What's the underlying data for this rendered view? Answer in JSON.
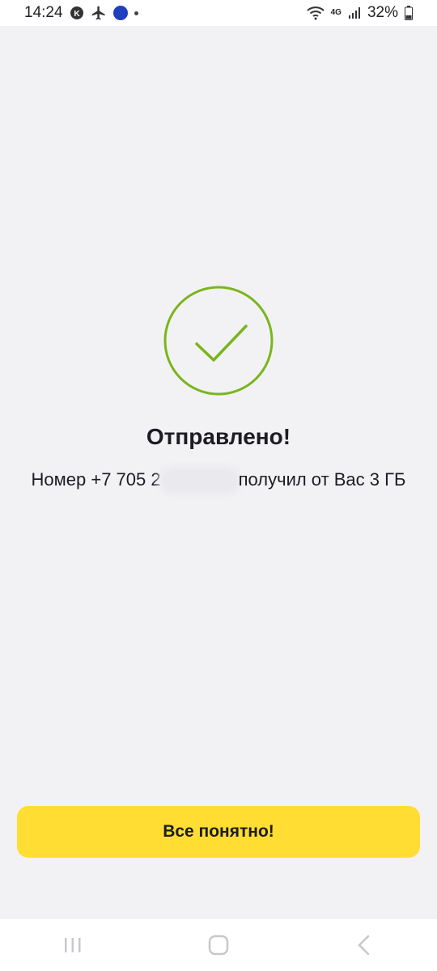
{
  "status_bar": {
    "time": "14:24",
    "battery": "32%",
    "network": "4G",
    "icons": [
      "app-notification-icon",
      "airplane-icon",
      "app-badge-icon",
      "dot-icon",
      "wifi-icon",
      "signal-icon",
      "battery-icon"
    ]
  },
  "result": {
    "icon": "checkmark-circle-icon",
    "title": "Отправлено!",
    "message_prefix": "Номер +7 705 2",
    "message_suffix": "получил от Вас 3 ГБ"
  },
  "actions": {
    "confirm_label": "Все понятно!"
  },
  "colors": {
    "background": "#f2f2f4",
    "accent_green": "#7ab51d",
    "button_yellow": "#ffdd33",
    "text": "#1c1c22"
  },
  "nav": {
    "icons": [
      "recent-apps-icon",
      "home-icon",
      "back-icon"
    ]
  }
}
